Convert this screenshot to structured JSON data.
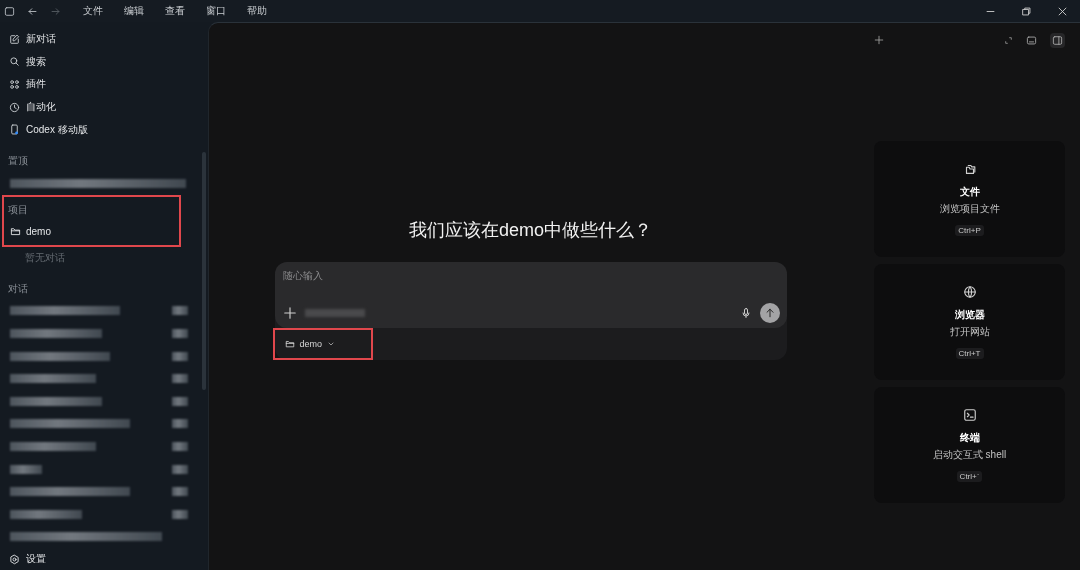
{
  "menu": [
    "文件",
    "编辑",
    "查看",
    "窗口",
    "帮助"
  ],
  "sidebar": {
    "nav": [
      {
        "label": "新对话"
      },
      {
        "label": "搜索"
      },
      {
        "label": "插件"
      },
      {
        "label": "自动化"
      },
      {
        "label": "Codex 移动版"
      }
    ],
    "sections": [
      {
        "kind": "pinned",
        "title": "置顶"
      },
      {
        "kind": "projects",
        "title": "项目",
        "highlighted": true,
        "projects": [
          {
            "name": "demo",
            "note": "暂无对话"
          }
        ]
      },
      {
        "kind": "chats",
        "title": "对话"
      }
    ],
    "settings": "设置"
  },
  "main": {
    "heading": "我们应该在demo中做些什么？",
    "composer": {
      "placeholder": "随心输入",
      "folder": "demo",
      "highlighted": true
    }
  },
  "cards": [
    {
      "title": "文件",
      "description": "浏览项目文件",
      "shortcut": "Ctrl+P"
    },
    {
      "title": "浏览器",
      "description": "打开网站",
      "shortcut": "Ctrl+T"
    },
    {
      "title": "终端",
      "description": "启动交互式 shell",
      "shortcut": "Ctrl+`"
    }
  ]
}
